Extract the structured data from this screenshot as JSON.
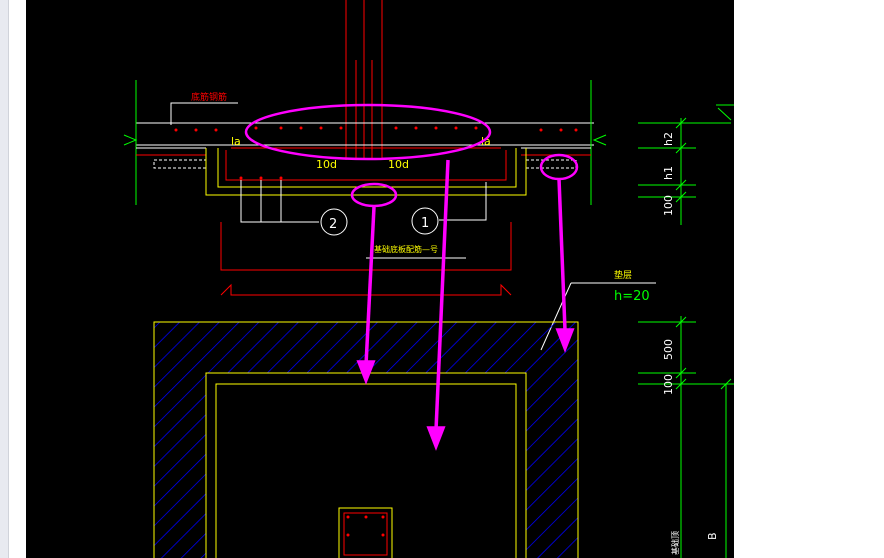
{
  "viewer": {
    "title": ""
  },
  "labels": {
    "top_rebar": "底筋钢筋",
    "la_left": "la",
    "la_right": "la",
    "d10_left": "10d",
    "d10_right": "10d",
    "callout_1": "1",
    "callout_2": "2",
    "section_note": "基础底板配筋—号",
    "cushion": "垫层",
    "h_value": "h=20",
    "dim_h2": "h2",
    "dim_h1": "h1",
    "dim_100_top": "100",
    "dim_500": "500",
    "dim_100_bottom": "100",
    "dim_B": "B",
    "dim_bottom_small": "基础顶"
  },
  "colors": {
    "background": "#000000",
    "outline": "#ffff00",
    "rebar": "#ff0000",
    "dimension": "#00ff00",
    "annotation": "#ffffff",
    "highlight": "#ff00ff"
  }
}
